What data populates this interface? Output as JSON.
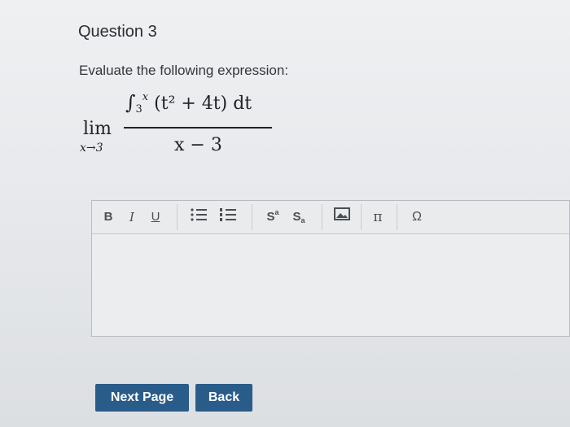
{
  "question": {
    "title": "Question 3",
    "instruction": "Evaluate the following expression:"
  },
  "expression": {
    "lim": "lim",
    "lim_sub": "x→3",
    "integral": "∫",
    "lower": "3",
    "upper": "x",
    "integrand": "(t² + 4t) dt",
    "denominator": "x − 3"
  },
  "toolbar": {
    "bold": "B",
    "italic": "I",
    "underline": "U",
    "bullets_icon": "bulleted-list-icon",
    "numbers_icon": "numbered-list-icon",
    "superscript": "S",
    "subscript": "S",
    "image_icon": "image-icon",
    "pi": "π",
    "omega": "Ω"
  },
  "buttons": {
    "next": "Next Page",
    "back": "Back"
  }
}
